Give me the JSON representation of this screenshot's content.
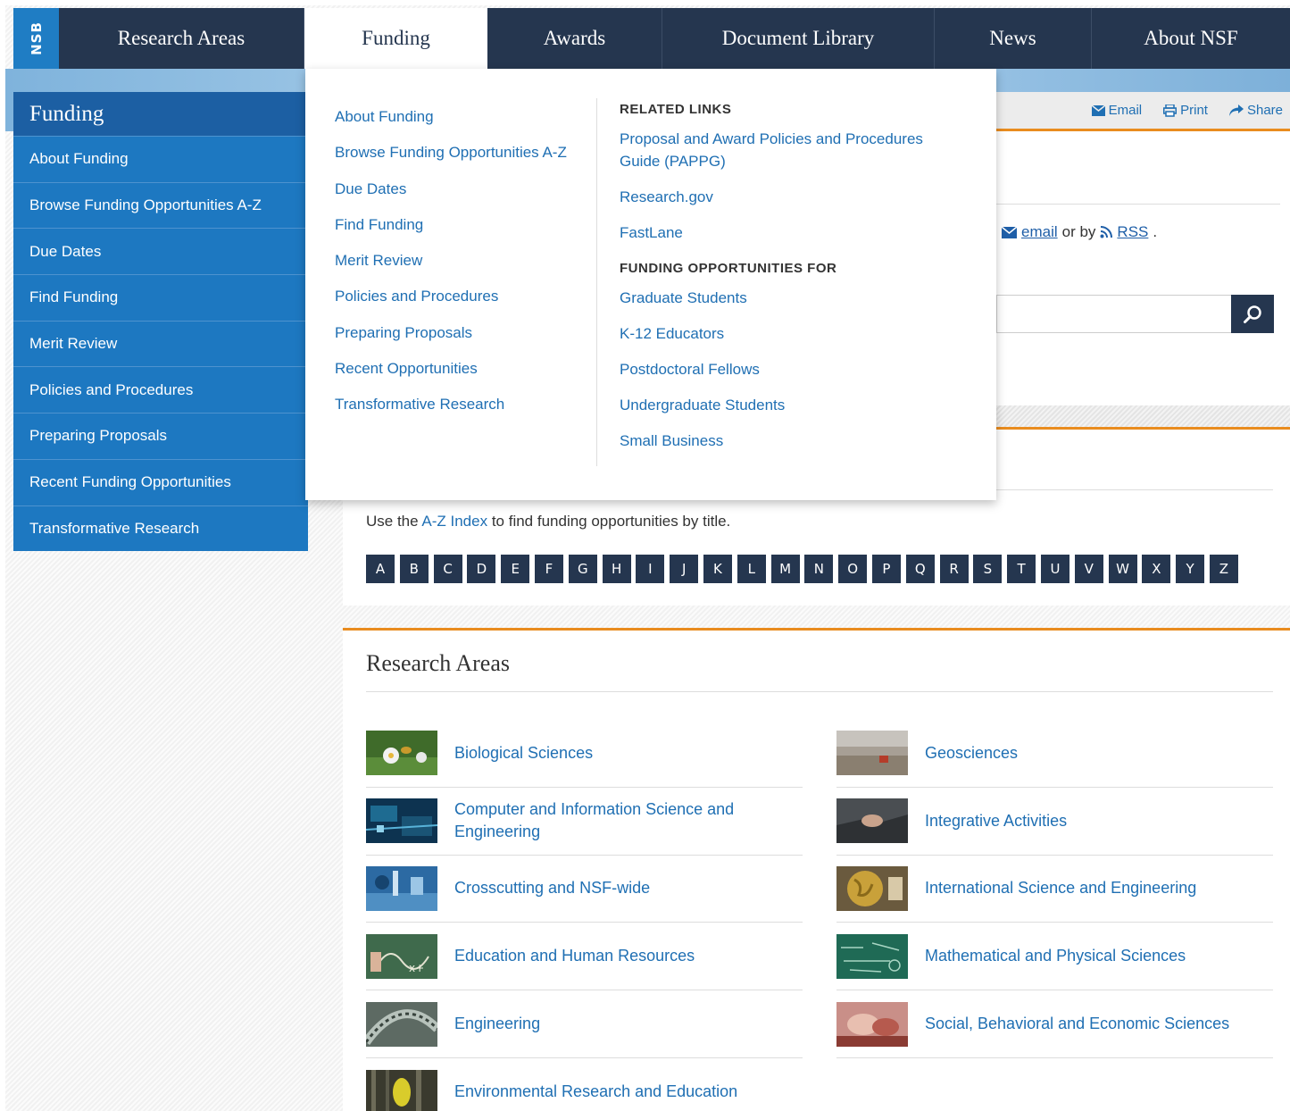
{
  "brand": {
    "badge": "NSB"
  },
  "topnav": {
    "items": [
      {
        "label": "Research Areas"
      },
      {
        "label": "Funding"
      },
      {
        "label": "Awards"
      },
      {
        "label": "Document Library"
      },
      {
        "label": "News"
      },
      {
        "label": "About NSF"
      }
    ]
  },
  "share": {
    "email": "Email",
    "print": "Print",
    "share": "Share"
  },
  "sidebar": {
    "title": "Funding",
    "items": [
      {
        "label": "About Funding"
      },
      {
        "label": "Browse Funding Opportunities A-Z"
      },
      {
        "label": "Due Dates"
      },
      {
        "label": "Find Funding"
      },
      {
        "label": "Merit Review"
      },
      {
        "label": "Policies and Procedures"
      },
      {
        "label": "Preparing Proposals"
      },
      {
        "label": "Recent Funding Opportunities"
      },
      {
        "label": "Transformative Research"
      }
    ]
  },
  "subscribe": {
    "email_link": "email",
    "or_by": "or by",
    "rss_link": "RSS",
    "end": "."
  },
  "dropdown": {
    "col1": [
      "About Funding",
      "Browse Funding Opportunities A-Z",
      "Due Dates",
      "Find Funding",
      "Merit Review",
      "Policies and Procedures",
      "Preparing Proposals",
      "Recent Opportunities",
      "Transformative Research"
    ],
    "related_heading": "RELATED LINKS",
    "related": [
      "Proposal and Award Policies and Procedures Guide (PAPPG)",
      "Research.gov",
      "FastLane"
    ],
    "opps_heading": "FUNDING OPPORTUNITIES FOR",
    "opps": [
      "Graduate Students",
      "K-12 Educators",
      "Postdoctoral Fellows",
      "Undergraduate Students",
      "Small Business"
    ]
  },
  "az": {
    "prefix": "Use the",
    "link": "A-Z Index",
    "suffix": "to find funding opportunities by title.",
    "letters": [
      "A",
      "B",
      "C",
      "D",
      "E",
      "F",
      "G",
      "H",
      "I",
      "J",
      "K",
      "L",
      "M",
      "N",
      "O",
      "P",
      "Q",
      "R",
      "S",
      "T",
      "U",
      "V",
      "W",
      "X",
      "Y",
      "Z"
    ]
  },
  "research": {
    "title": "Research Areas",
    "left": [
      {
        "label": "Biological Sciences"
      },
      {
        "label": "Computer and Information Science and Engineering"
      },
      {
        "label": "Crosscutting and NSF-wide"
      },
      {
        "label": "Education and Human Resources"
      },
      {
        "label": "Engineering"
      },
      {
        "label": "Environmental Research and Education"
      }
    ],
    "right": [
      {
        "label": "Geosciences"
      },
      {
        "label": "Integrative Activities"
      },
      {
        "label": "International Science and Engineering"
      },
      {
        "label": "Mathematical and Physical Sciences"
      },
      {
        "label": "Social, Behavioral and Economic Sciences"
      }
    ]
  },
  "colors": {
    "navy": "#25364f",
    "blue": "#1d78c1",
    "link": "#1f6fb3",
    "accent": "#e98c1f"
  }
}
